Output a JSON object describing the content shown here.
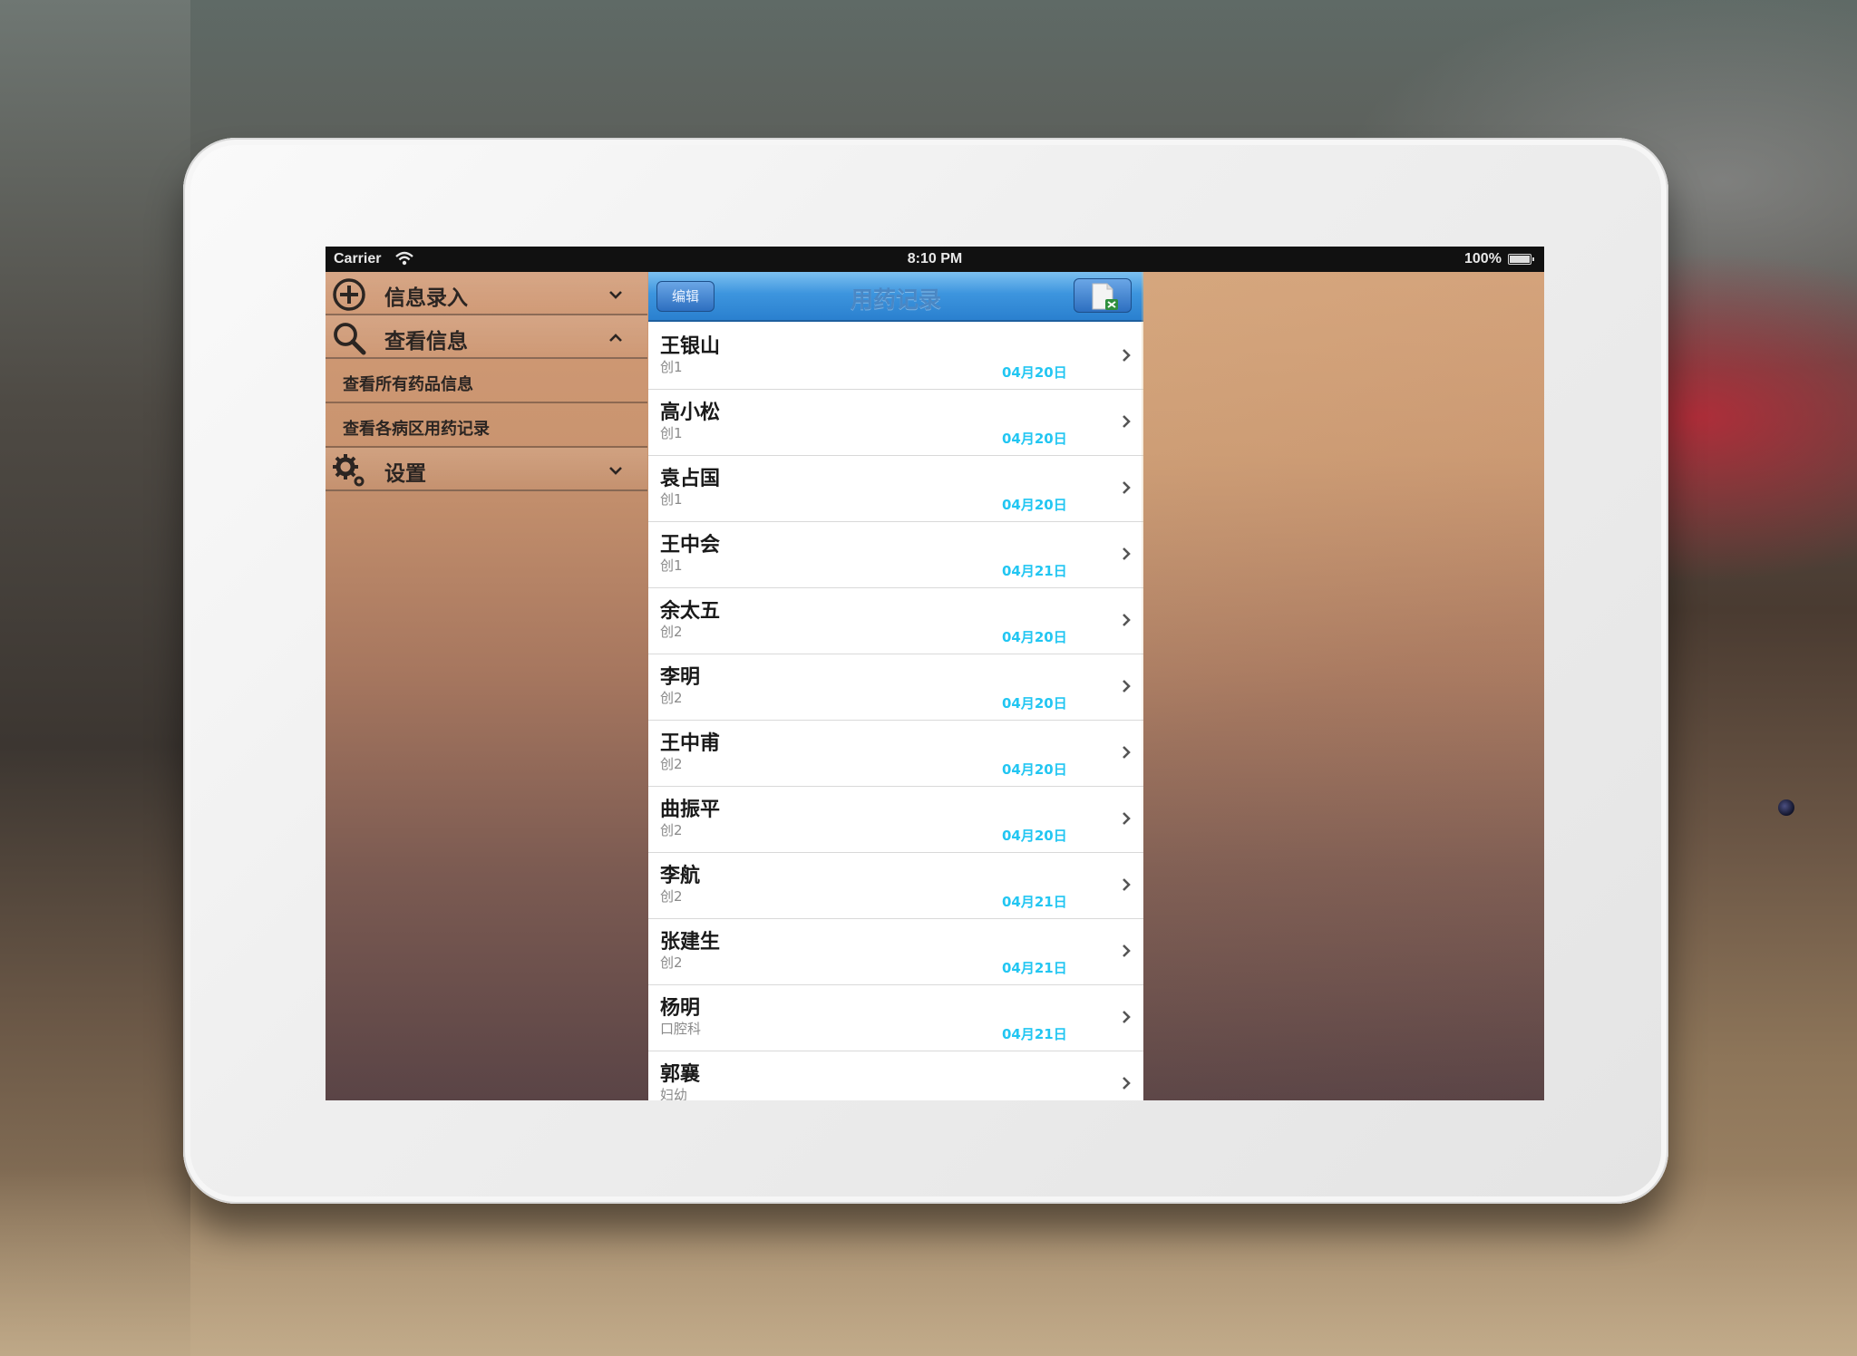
{
  "status_bar": {
    "carrier": "Carrier",
    "time": "8:10 PM",
    "battery": "100%"
  },
  "sidebar": {
    "sections": [
      {
        "label": "信息录入",
        "icon": "plus-circle-icon",
        "expanded": false
      },
      {
        "label": "查看信息",
        "icon": "magnifier-icon",
        "expanded": true,
        "items": [
          "查看所有药品信息",
          "查看各病区用药记录"
        ]
      },
      {
        "label": "设置",
        "icon": "gears-icon",
        "expanded": false
      }
    ]
  },
  "list_panel": {
    "title": "用药记录",
    "edit_label": "编辑",
    "export_icon": "export-excel-icon",
    "rows": [
      {
        "name": "王银山",
        "dept": "创1",
        "date": "04月20日"
      },
      {
        "name": "高小松",
        "dept": "创1",
        "date": "04月20日"
      },
      {
        "name": "袁占国",
        "dept": "创1",
        "date": "04月20日"
      },
      {
        "name": "王中会",
        "dept": "创1",
        "date": "04月21日"
      },
      {
        "name": "余太五",
        "dept": "创2",
        "date": "04月20日"
      },
      {
        "name": "李明",
        "dept": "创2",
        "date": "04月20日"
      },
      {
        "name": "王中甫",
        "dept": "创2",
        "date": "04月20日"
      },
      {
        "name": "曲振平",
        "dept": "创2",
        "date": "04月20日"
      },
      {
        "name": "李航",
        "dept": "创2",
        "date": "04月21日"
      },
      {
        "name": "张建生",
        "dept": "创2",
        "date": "04月21日"
      },
      {
        "name": "杨明",
        "dept": "口腔科",
        "date": "04月21日"
      },
      {
        "name": "郭襄",
        "dept": "妇幼",
        "date": ""
      }
    ]
  },
  "colors": {
    "nav_blue": "#3d95de",
    "date_cyan": "#22c6f2"
  }
}
